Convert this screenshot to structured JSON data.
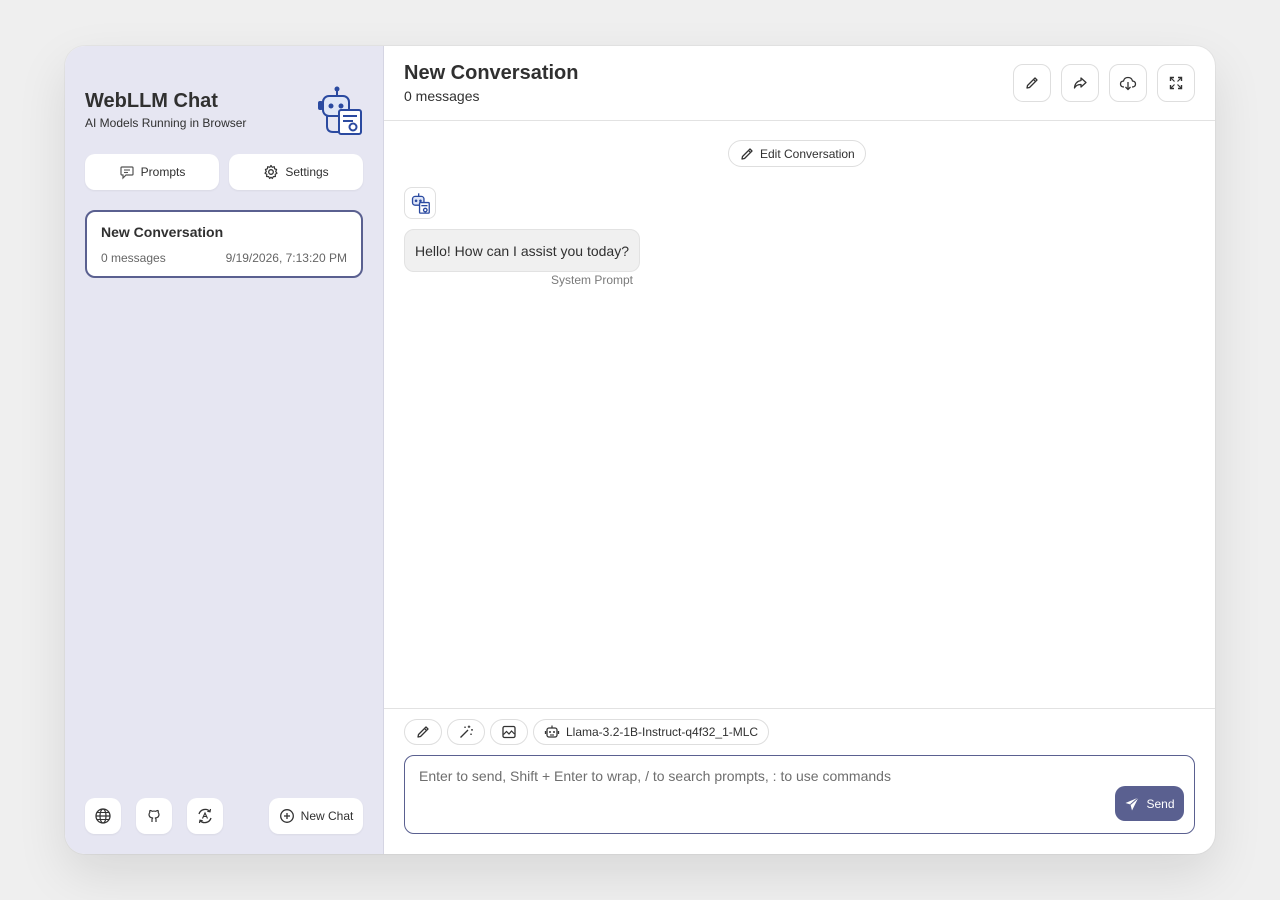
{
  "app": {
    "title": "WebLLM Chat",
    "subtitle": "AI Models Running in Browser"
  },
  "sidebar": {
    "prompts_label": "Prompts",
    "settings_label": "Settings",
    "conversations": [
      {
        "title": "New Conversation",
        "count": "0 messages",
        "date": "9/19/2026, 7:13:20 PM",
        "selected": true
      }
    ],
    "new_chat_label": "New Chat",
    "footer_icons": [
      "globe-icon",
      "github-icon",
      "language-switch-icon"
    ]
  },
  "header": {
    "title": "New Conversation",
    "subtitle": "0 messages",
    "action_icons": [
      "edit-icon",
      "share-icon",
      "download-icon",
      "fullscreen-icon"
    ]
  },
  "conversation": {
    "edit_label": "Edit Conversation",
    "messages": [
      {
        "role": "assistant",
        "text": "Hello! How can I assist you today?",
        "meta": "System Prompt"
      }
    ]
  },
  "composer": {
    "model_name": "Llama-3.2-1B-Instruct-q4f32_1-MLC",
    "placeholder": "Enter to send, Shift + Enter to wrap, / to search prompts, : to use commands",
    "value": "",
    "send_label": "Send",
    "chip_icons": [
      "edit-icon",
      "magic-wand-icon",
      "image-icon",
      "robot-icon"
    ]
  },
  "colors": {
    "accent": "#5a6090",
    "sidebar_bg": "#e6e6f2",
    "logo_blue": "#2b4aa0"
  }
}
